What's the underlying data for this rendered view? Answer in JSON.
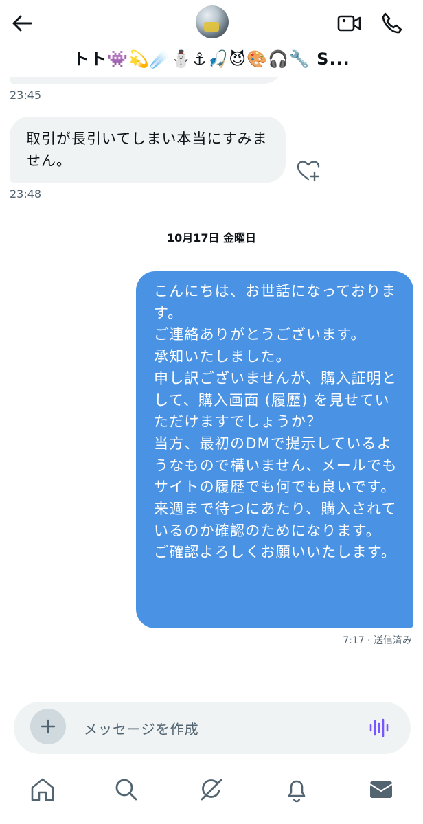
{
  "header": {
    "title": "トト👾💫☄️⛄⚓🎣😈🎨🎧🔧  S..."
  },
  "messages": [
    {
      "time": "23:45"
    },
    {
      "text": "取引が長引いてしまい本当にすみませ​ん。",
      "time": "23:48"
    }
  ],
  "date_separator": "10月17日 金曜日",
  "outgoing": {
    "text": "こんにちは、お世話になっております。\nご連絡ありがとうございます。\n承知いたしました。\n申し訳ございませんが、購入証明として、購入画面 (履歴) を見せていただけますでしょうか？\n当方、最初のDMで提示しているようなもので構いません、メールでもサイトの履歴でも何でも良いです。\n来週まで待つにあたり、購入されているのか確認のためになります。\nご確認よろしくお願いいたします。",
    "status": "7:17 · 送信済み"
  },
  "composer": {
    "placeholder": "メッセージを作成"
  },
  "colors": {
    "accent": "#4a93e4",
    "incoming_bubble": "#eff3f4",
    "voice": "#7856ff"
  },
  "icons": [
    "back-arrow-icon",
    "video-call-icon",
    "phone-icon",
    "heart-plus-icon",
    "plus-icon",
    "voice-wave-icon",
    "home-icon",
    "search-icon",
    "grok-icon",
    "bell-icon",
    "mail-icon"
  ]
}
